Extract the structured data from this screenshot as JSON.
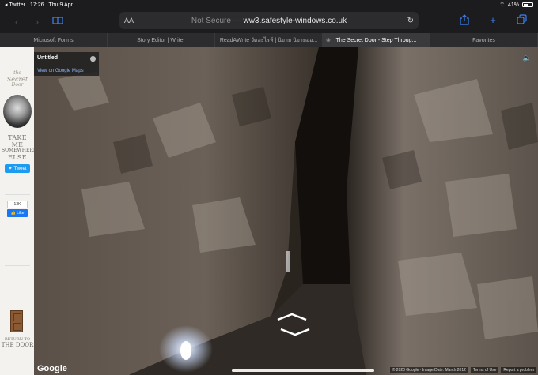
{
  "status_bar": {
    "back_app": "Twitter",
    "time": "17:26",
    "date": "Thu 9 Apr",
    "battery": "41%"
  },
  "toolbar": {
    "reader_label": "AA",
    "security": "Not Secure",
    "separator": "—",
    "domain": "ww3.safestyle-windows.co.uk"
  },
  "tabs": [
    {
      "label": "Microsoft Forms",
      "active": false
    },
    {
      "label": "Story Editor | Writer",
      "active": false
    },
    {
      "label": "ReadAWrite วัดอะไรห์ | นิยาย นิยายออ...",
      "active": false
    },
    {
      "label": "The Secret Door - Step Throug...",
      "active": true
    },
    {
      "label": "Favorites",
      "active": false
    }
  ],
  "sidebar": {
    "logo_line1": "the",
    "logo_line2": "Secret",
    "logo_line3": "Door",
    "take_me": "TAKE ME",
    "somewhere": "SOMEWHERE",
    "else": "ELSE",
    "tweet_label": "Tweet",
    "like_count": "13K",
    "like_label": "Like",
    "return_to": "RETURN TO",
    "the_door": "THE DOOR"
  },
  "streetview": {
    "info_title": "Untitled",
    "info_link": "View on Google Maps",
    "google_logo": "Google",
    "copyright": "© 2020 Google · Image Date: March 2012",
    "terms": "Terms of Use",
    "report": "Report a problem"
  },
  "colors": {
    "accent": "#3b82f6",
    "twitter": "#1d9bf0",
    "facebook": "#1877f2"
  }
}
